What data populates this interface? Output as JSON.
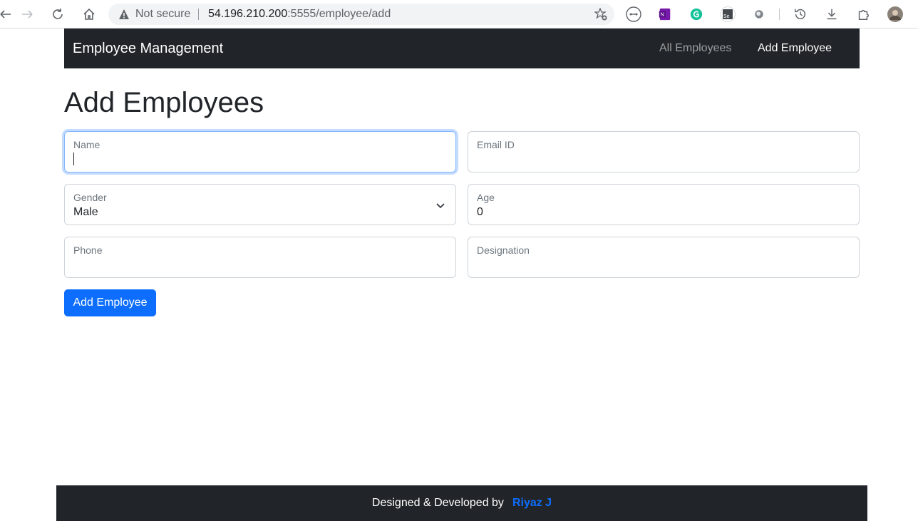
{
  "browser": {
    "security_text": "Not secure",
    "url_host": "54.196.210.200",
    "url_path": ":5555/employee/add",
    "icons": [
      "back-icon",
      "forward-icon",
      "reload-icon",
      "home-icon",
      "warning-icon",
      "add-favorite-icon",
      "extension-icon",
      "onenote-icon",
      "grammarly-icon",
      "selenium-icon",
      "extension-circle-icon",
      "history-icon",
      "download-icon",
      "extensions-puzzle-icon",
      "profile-avatar"
    ]
  },
  "navbar": {
    "brand": "Employee Management",
    "links": [
      {
        "label": "All Employees",
        "active": false
      },
      {
        "label": "Add Employee",
        "active": true
      }
    ]
  },
  "page": {
    "title": "Add Employees"
  },
  "form": {
    "name": {
      "label": "Name",
      "value": ""
    },
    "email": {
      "label": "Email ID",
      "value": ""
    },
    "gender": {
      "label": "Gender",
      "value": "Male"
    },
    "age": {
      "label": "Age",
      "value": "0"
    },
    "phone": {
      "label": "Phone",
      "value": ""
    },
    "designation": {
      "label": "Designation",
      "value": ""
    },
    "submit_label": "Add Employee"
  },
  "footer": {
    "text": "Designed & Developed by",
    "author": "Riyaz J"
  },
  "colors": {
    "navbar_bg": "#212529",
    "primary": "#0d6efd",
    "focus_border": "#86b7fe"
  }
}
